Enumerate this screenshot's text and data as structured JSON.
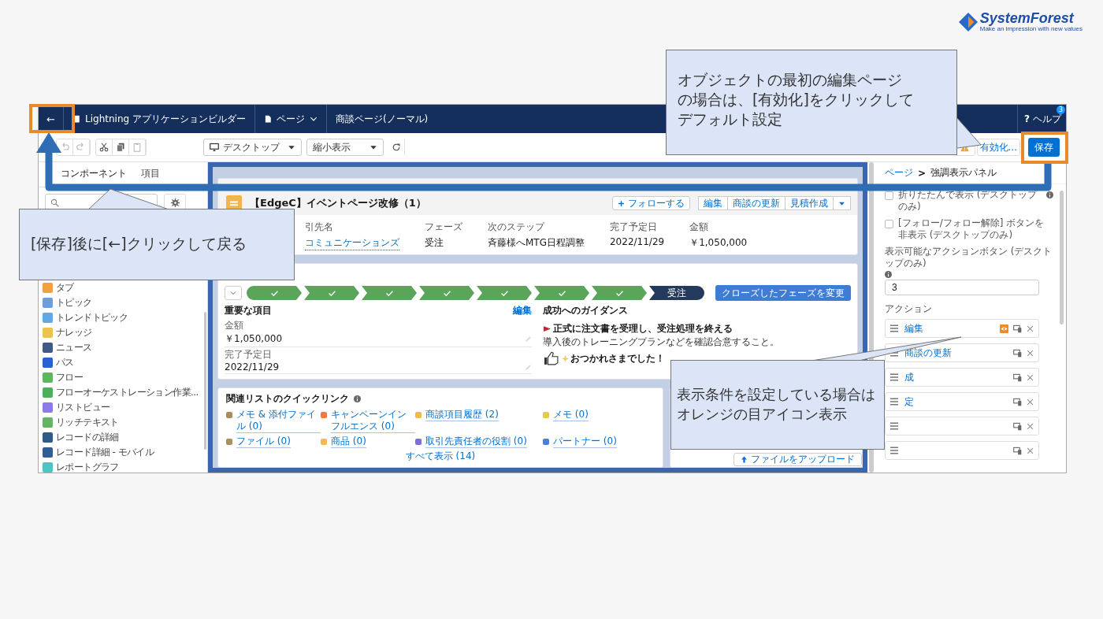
{
  "logo": {
    "name": "SystemForest",
    "tagline": "Make an impression with new values"
  },
  "header": {
    "back": "←",
    "app_title": "Lightning アプリケーションビルダー",
    "page_menu": "ページ",
    "page_name": "商談ページ(ノーマル)",
    "help_icon": "?",
    "help": "ヘルプ",
    "help_badge": "3"
  },
  "toolbar": {
    "device": "デスクトップ",
    "view": "縮小表示",
    "activate": "有効化...",
    "save": "保存"
  },
  "left_panel": {
    "tabs": [
      {
        "label": "コンポーネント",
        "selected": true
      },
      {
        "label": "項目",
        "selected": false
      }
    ],
    "components": [
      {
        "label": "タブ",
        "color": "#f2a23c"
      },
      {
        "label": "トピック",
        "color": "#6a9fdc"
      },
      {
        "label": "トレンドトピック",
        "color": "#62a8e5"
      },
      {
        "label": "ナレッジ",
        "color": "#eac44e"
      },
      {
        "label": "ニュース",
        "color": "#3e5a87"
      },
      {
        "label": "パス",
        "color": "#2b5fd6"
      },
      {
        "label": "フロー",
        "color": "#5db75d"
      },
      {
        "label": "フローオーケストレーション作業...",
        "color": "#4fae5a"
      },
      {
        "label": "リストビュー",
        "color": "#8c7ae6"
      },
      {
        "label": "リッチテキスト",
        "color": "#63b562"
      },
      {
        "label": "レコードの詳細",
        "color": "#2e5b8a"
      },
      {
        "label": "レコード詳細 - モバイル",
        "color": "#2f5f91"
      },
      {
        "label": "レポートグラフ",
        "color": "#4fc3c3"
      }
    ]
  },
  "record": {
    "title": "【EdgeC】イベントページ改修（1）",
    "follow": "フォローする",
    "actions": [
      "編集",
      "商談の更新",
      "見積作成"
    ],
    "fields": [
      {
        "label": "引先名",
        "value": "コミュニケーションズ",
        "kind": "link"
      },
      {
        "label": "フェーズ",
        "value": "受注",
        "kind": "text"
      },
      {
        "label": "次のステップ",
        "value": "斉藤様へMTG日程調整",
        "kind": "text"
      },
      {
        "label": "完了予定日",
        "value": "2022/11/29",
        "kind": "text"
      },
      {
        "label": "金額",
        "value": "￥1,050,000",
        "kind": "text"
      }
    ]
  },
  "path": {
    "stages": [
      {
        "complete": true
      },
      {
        "complete": true
      },
      {
        "complete": true
      },
      {
        "complete": true
      },
      {
        "complete": true
      },
      {
        "complete": true
      },
      {
        "complete": true
      },
      {
        "label": "受注",
        "complete": false
      }
    ],
    "change_button": "クローズしたフェーズを変更",
    "key_fields": {
      "title": "重要な項目",
      "edit": "編集",
      "fields": [
        {
          "label": "金額",
          "value": "￥1,050,000"
        },
        {
          "label": "完了予定日",
          "value": "2022/11/29"
        }
      ]
    },
    "guidance": {
      "title": "成功へのガイダンス",
      "heading": "正式に注文書を受理し、受注処理を終える",
      "text": "導入後のトレーニングプランなどを確認合意すること。",
      "closing": "おつかれさまでした！"
    }
  },
  "quick_links": {
    "title": "関連リストのクイックリンク",
    "links": [
      {
        "label": "メモ & 添付ファイル (0)",
        "color": "#a88d5a"
      },
      {
        "label": "キャンペーンインフルエンス (0)",
        "color": "#f07b3f"
      },
      {
        "label": "商談項目履歴 (2)",
        "color": "#f2b84b"
      },
      {
        "label": "メモ (0)",
        "color": "#e8c94a"
      },
      {
        "label": "ファイル (0)",
        "color": "#a89060"
      },
      {
        "label": "商品 (0)",
        "color": "#f5b94f"
      },
      {
        "label": "取引先責任者の役割 (0)",
        "color": "#7b6fd6"
      },
      {
        "label": "パートナー (0)",
        "color": "#4b7fd8"
      }
    ],
    "show_all": "すべて表示 (14)"
  },
  "files": {
    "upload": "ファイルをアップロード"
  },
  "properties": {
    "breadcrumb": {
      "root": "ページ",
      "separator": ">",
      "current": "強調表示パネル"
    },
    "options": [
      {
        "label": "折りたたんで表示 (デスクトップのみ)",
        "checked": false,
        "info": true
      },
      {
        "label": "[フォロー/フォロー解除] ボタンを非表示 (デスクトップのみ)",
        "checked": false,
        "info": false
      }
    ],
    "action_count": {
      "label": "表示可能なアクションボタン (デスクトップのみ)",
      "value": "3"
    },
    "actions_label": "アクション",
    "actions": [
      {
        "label": "編集",
        "condition": true
      },
      {
        "label": "商談の更新",
        "condition": false
      },
      {
        "label": "成",
        "condition": false
      },
      {
        "label": "定",
        "condition": false
      },
      {
        "condition": false
      },
      {
        "condition": false
      }
    ]
  },
  "callouts": [
    {
      "kind": "top",
      "lines": [
        "オブジェクトの最初の編集ページ",
        "の場合は、[有効化]をクリックして",
        "デフォルト設定"
      ]
    },
    {
      "kind": "left",
      "lines": [
        "[保存]後に[←]クリックして戻る"
      ]
    },
    {
      "kind": "bottom",
      "lines": [
        "表示条件を設定している場合は",
        "オレンジの目アイコン表示"
      ]
    }
  ]
}
